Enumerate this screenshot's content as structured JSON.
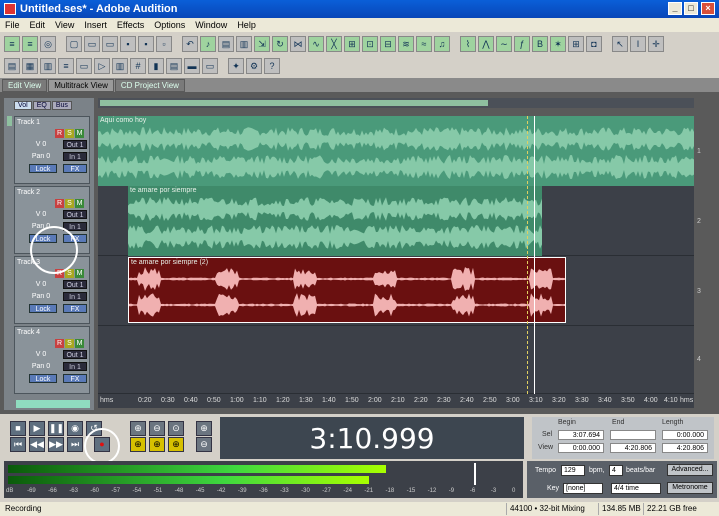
{
  "window": {
    "title": "Untitled.ses* - Adobe Audition"
  },
  "menu": [
    "File",
    "Edit",
    "View",
    "Insert",
    "Effects",
    "Options",
    "Window",
    "Help"
  ],
  "tabs": [
    {
      "label": "Edit View"
    },
    {
      "label": "Multitrack View"
    },
    {
      "label": "CD Project View"
    }
  ],
  "subtabs": [
    "Vol",
    "EQ",
    "Bus"
  ],
  "tracks": [
    {
      "name": "Track 1",
      "volume": "V 0",
      "pan": "Pan 0",
      "out": "Out 1",
      "in": "In 1",
      "lock": "Lock",
      "fx": "FX",
      "lane": "1"
    },
    {
      "name": "Track 2",
      "volume": "V 0",
      "pan": "Pan 0",
      "out": "Out 1",
      "in": "In 1",
      "lock": "Lock",
      "fx": "FX",
      "lane": "2"
    },
    {
      "name": "Track 3",
      "volume": "V 0",
      "pan": "Pan 0",
      "out": "Out 1",
      "in": "In 1",
      "lock": "Lock",
      "fx": "FX",
      "lane": "3"
    },
    {
      "name": "Track 4",
      "volume": "V 0",
      "pan": "Pan 0",
      "out": "Out 1",
      "in": "In 1",
      "lock": "Lock",
      "fx": "FX",
      "lane": "4"
    }
  ],
  "rsm": {
    "r": "R",
    "s": "S",
    "m": "M"
  },
  "clips": [
    {
      "name": "Aqui como hoy"
    },
    {
      "name": "te amare por siempre"
    },
    {
      "name": "te amare por siempre (2)"
    }
  ],
  "ruler": {
    "unit": "hms",
    "ticks": [
      "0:20",
      "0:30",
      "0:40",
      "0:50",
      "1:00",
      "1:10",
      "1:20",
      "1:30",
      "1:40",
      "1:50",
      "2:00",
      "2:10",
      "2:20",
      "2:30",
      "2:40",
      "2:50",
      "3:00",
      "3:10",
      "3:20",
      "3:30",
      "3:40",
      "3:50",
      "4:00",
      "4:10"
    ],
    "end_unit": "hms"
  },
  "transport": {
    "time": "3:10.999"
  },
  "selection": {
    "headers": {
      "begin": "Begin",
      "end": "End",
      "length": "Length"
    },
    "sel": {
      "label": "Sel",
      "begin": "3:07.694",
      "end": "",
      "length": "0:00.000"
    },
    "view": {
      "label": "View",
      "begin": "0:00.000",
      "end": "4:20.806",
      "length": "4:20.806"
    }
  },
  "meter": {
    "scale": [
      "dB",
      "-69",
      "-66",
      "-63",
      "-60",
      "-57",
      "-54",
      "-51",
      "-48",
      "-45",
      "-42",
      "-39",
      "-36",
      "-33",
      "-30",
      "-27",
      "-24",
      "-21",
      "-18",
      "-15",
      "-12",
      "-9",
      "-6",
      "-3",
      "0"
    ],
    "left_level": 0.86,
    "right_level": 0.82
  },
  "tempo": {
    "tempo_label": "Tempo",
    "tempo_value": "129",
    "bpm": "bpm,",
    "beats_value": "4",
    "beats_label": "beats/bar",
    "advanced": "Advanced...",
    "key_label": "Key",
    "key_value": "[none]",
    "time_sig": "4/4 time",
    "metronome": "Metronome"
  },
  "status": {
    "state": "Recording",
    "format": "44100 • 32-bit Mixing",
    "size": "134.85 MB",
    "free": "22.21 GB free"
  }
}
